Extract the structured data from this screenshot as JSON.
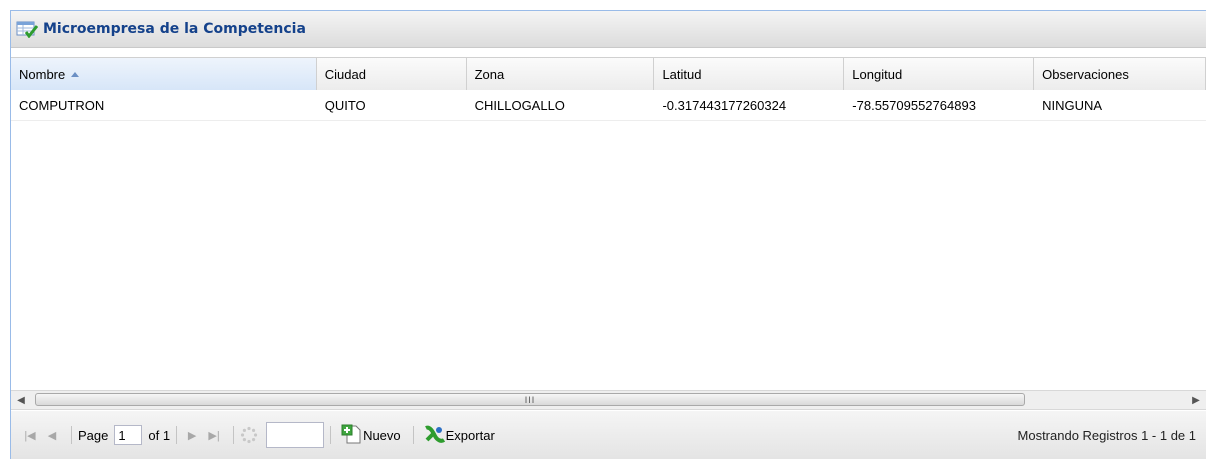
{
  "panel": {
    "title": "Microempresa de la Competencia",
    "icon": "grid-check-icon"
  },
  "grid": {
    "columns": [
      {
        "label": "Nombre"
      },
      {
        "label": "Ciudad"
      },
      {
        "label": "Zona"
      },
      {
        "label": "Latitud"
      },
      {
        "label": "Longitud"
      },
      {
        "label": "Observaciones"
      }
    ],
    "sort": {
      "column": "Nombre",
      "direction": "asc"
    },
    "rows": [
      [
        "COMPUTRON",
        "QUITO",
        "CHILLOGALLO",
        "-0.317443177260324",
        "-78.55709552764893",
        "NINGUNA"
      ]
    ]
  },
  "scrollbar": {
    "grip": "III"
  },
  "paging": {
    "page_label": "Page",
    "page_value": "1",
    "of_label": "of 1",
    "nuevo_label": "Nuevo",
    "exportar_label": "Exportar",
    "status_text": "Mostrando Registros 1 - 1 de 1"
  },
  "colors": {
    "accent": "#15428b",
    "header_border": "#99bbe8",
    "sorted_header": "#d7e6f8"
  }
}
